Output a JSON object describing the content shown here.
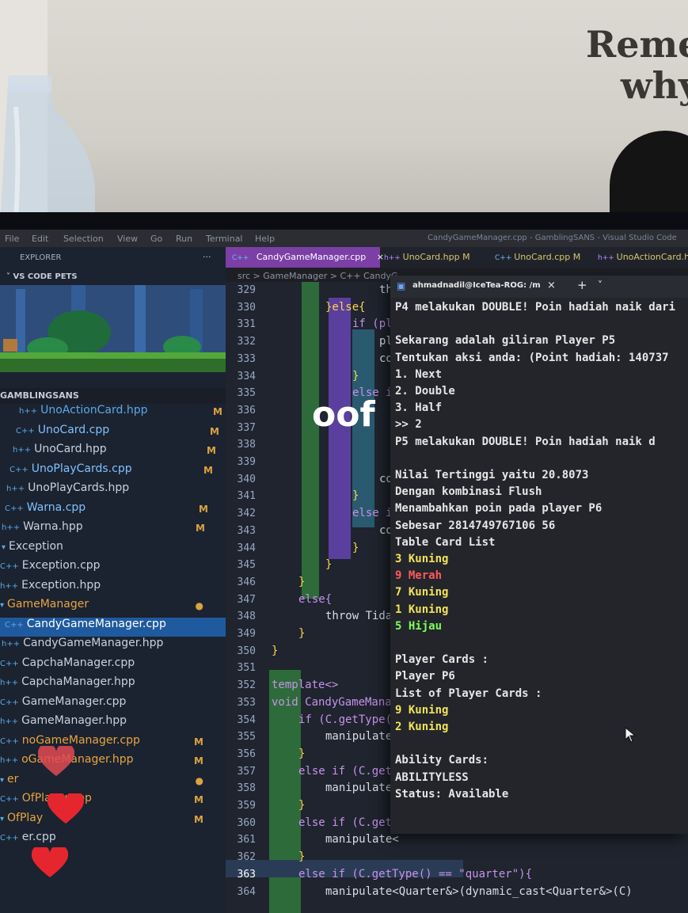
{
  "background": {
    "board_text": [
      "Reme",
      "why"
    ]
  },
  "overlay": {
    "caption": "oof"
  },
  "vscode": {
    "menu": [
      "File",
      "Edit",
      "Selection",
      "View",
      "Go",
      "Run",
      "Terminal",
      "Help"
    ],
    "window_title": "CandyGameManager.cpp - GamblingSANS - Visual Studio Code",
    "explorer_label": "EXPLORER",
    "explorer_more": "···",
    "pets_section": "VS CODE PETS",
    "project_section": "GAMBLINGSANS",
    "tabs": [
      {
        "label": "CandyGameManager.cpp",
        "close": "×"
      },
      {
        "label": "UnoCard.hpp M"
      },
      {
        "label": "UnoCard.cpp M"
      },
      {
        "label": "UnoActionCard.h"
      }
    ],
    "breadcrumb": "src > GameManager > C++ CandyG",
    "file_tree": [
      {
        "label": "UnoActionCard.hpp",
        "badge": "M"
      },
      {
        "label": "UnoCard.cpp",
        "badge": "M"
      },
      {
        "label": "UnoCard.hpp",
        "badge": "M"
      },
      {
        "label": "UnoPlayCards.cpp",
        "badge": "M"
      },
      {
        "label": "UnoPlayCards.hpp",
        "badge": ""
      },
      {
        "label": "Warna.cpp",
        "badge": "M"
      },
      {
        "label": "Warna.hpp",
        "badge": "M"
      },
      {
        "label": "Exception",
        "badge": ""
      },
      {
        "label": "Exception.cpp",
        "badge": ""
      },
      {
        "label": "Exception.hpp",
        "badge": ""
      },
      {
        "label": "GameManager",
        "badge": "●"
      },
      {
        "label": "CandyGameManager.cpp",
        "badge": ""
      },
      {
        "label": "CandyGameManager.hpp",
        "badge": ""
      },
      {
        "label": "CapchaManager.cpp",
        "badge": ""
      },
      {
        "label": "CapchaManager.hpp",
        "badge": ""
      },
      {
        "label": "GameManager.cpp",
        "badge": ""
      },
      {
        "label": "GameManager.hpp",
        "badge": ""
      },
      {
        "label": "noGameManager.cpp",
        "badge": "M"
      },
      {
        "label": "oGameManager.hpp",
        "badge": "M"
      },
      {
        "label": "er",
        "badge": "●"
      },
      {
        "label": "OfPlayer.cpp",
        "badge": "M"
      },
      {
        "label": "OfPlay",
        "badge": "M"
      },
      {
        "label": "er.cpp",
        "badge": ""
      }
    ],
    "line_numbers": [
      "329",
      "330",
      "331",
      "332",
      "333",
      "334",
      "335",
      "336",
      "337",
      "338",
      "339",
      "340",
      "341",
      "342",
      "343",
      "344",
      "345",
      "346",
      "347",
      "348",
      "349",
      "350",
      "351",
      "352",
      "353",
      "354",
      "355",
      "356",
      "357",
      "358",
      "359",
      "360",
      "361",
      "362",
      "363",
      "364"
    ],
    "code_lines": [
      "throw",
      "}else{",
      "if (pla",
      "pla",
      "co",
      "}",
      "else i",
      "",
      "",
      "",
      "",
      "co",
      "}",
      "else i",
      "co",
      "}",
      "}",
      "}",
      "else{",
      "throw Tidal",
      "}",
      "}",
      "",
      "template<>",
      "void CandyGameManag",
      "if (C.getType(",
      "manipulate",
      "}",
      "else if (C.get",
      "manipulate",
      "}",
      "else if (C.get",
      "manipulate<",
      "}",
      "else if (C.getType() == \"quarter\"){",
      "manipulate<Quarter&>(dynamic_cast<Quarter&>(C)"
    ]
  },
  "terminal": {
    "tab_title": "ahmadnadil@IceTea-ROG: /m",
    "tab_close": "×",
    "new_tab": "+",
    "dropdown": "˅",
    "lines": [
      "P4 melakukan DOUBLE! Poin hadiah naik dari",
      "",
      "Sekarang adalah giliran Player P5",
      "Tentukan aksi anda: (Point hadiah: 140737",
      "1. Next",
      "2. Double",
      "3. Half",
      ">> 2",
      "P5 melakukan DOUBLE! Poin hadiah naik d",
      "",
      "Nilai Tertinggi yaitu 20.8073",
      "Dengan kombinasi Flush",
      "Menambahkan poin pada player P6",
      "Sebesar 2814749767106 56",
      "Table Card List",
      "3 Kuning",
      "9 Merah",
      "7 Kuning",
      "1 Kuning",
      "5 Hijau",
      "",
      "Player Cards :",
      "Player P6",
      "List of Player Cards :",
      "9 Kuning",
      "2 Kuning",
      "",
      "Ability Cards:",
      "ABILITYLESS",
      "Status: Available"
    ],
    "line_colors": {
      "default": "#e6e6e6",
      "kuning": "#f2e35a",
      "merah": "#ff5a5a",
      "hijau": "#7dff5a"
    }
  }
}
